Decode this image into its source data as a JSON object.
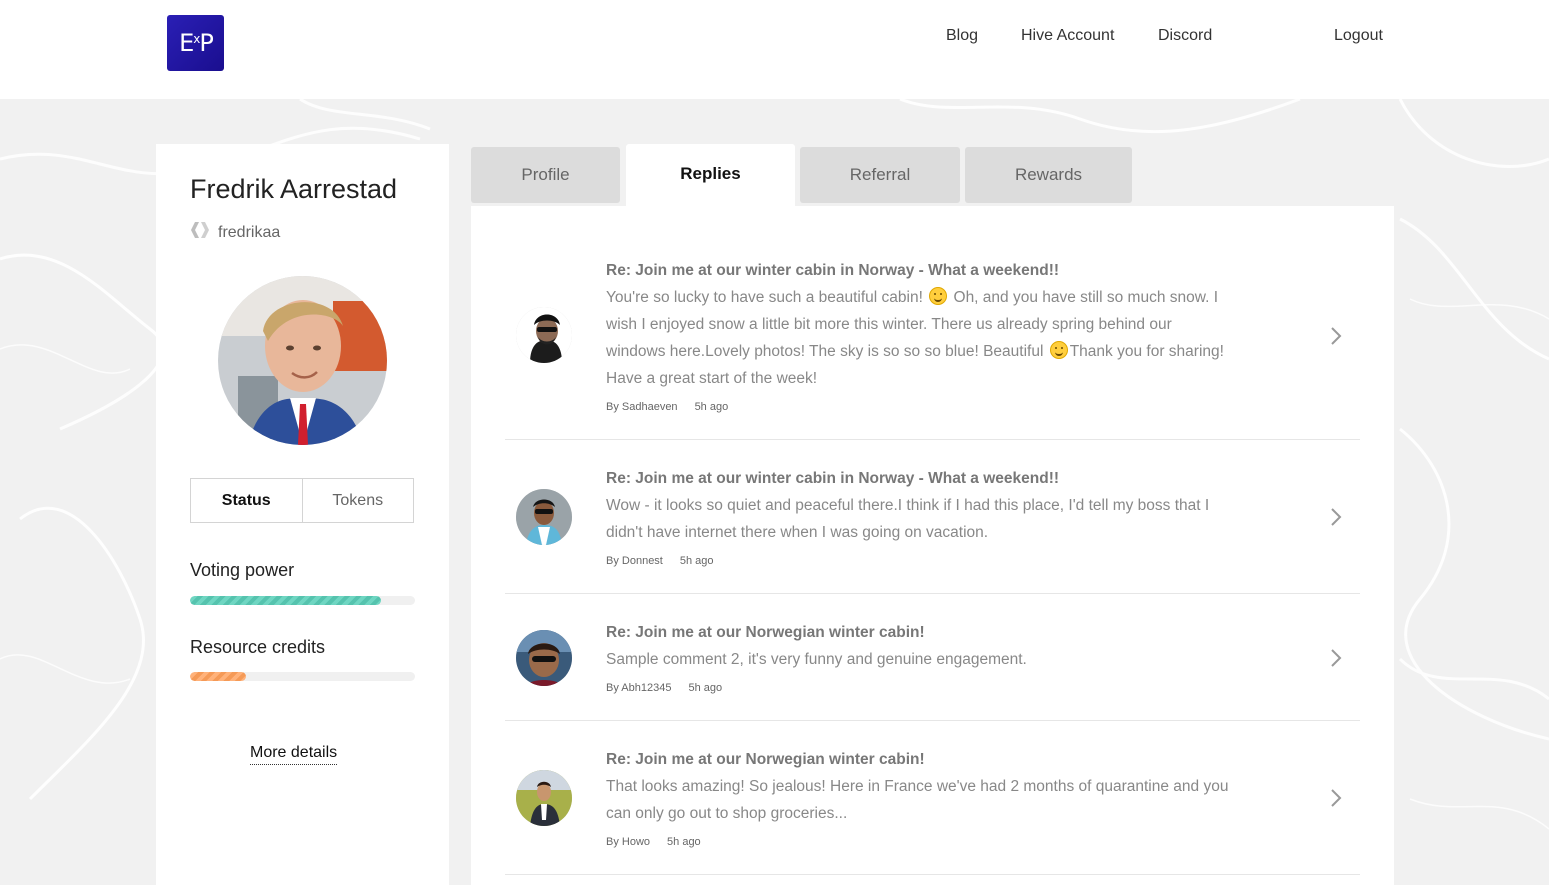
{
  "header": {
    "logo_text": "ExP",
    "nav": [
      {
        "label": "Blog"
      },
      {
        "label": "Hive Account"
      },
      {
        "label": "Discord"
      },
      {
        "label": "Logout"
      }
    ]
  },
  "profile": {
    "name": "Fredrik Aarrestad",
    "handle": "fredrikaa",
    "handle_icon": "hive-icon",
    "toggle": {
      "status": "Status",
      "tokens": "Tokens",
      "selected": "Status"
    },
    "voting_power_label": "Voting power",
    "voting_power_fraction": 0.85,
    "resource_credits_label": "Resource credits",
    "resource_credits_fraction": 0.25,
    "more_details": "More details"
  },
  "tabs": [
    {
      "label": "Profile",
      "active": false
    },
    {
      "label": "Replies",
      "active": true
    },
    {
      "label": "Referral",
      "active": false
    },
    {
      "label": "Rewards",
      "active": false
    }
  ],
  "replies": [
    {
      "title": "Re: Join me at our winter cabin in Norway - What a weekend!!",
      "lines": [
        "You're so lucky to have such a beautiful cabin! [emoji] Oh, and you have still so much snow. I",
        "wish I enjoyed snow a little bit more this winter. There us already spring behind our",
        "windows here.Lovely photos! The sky is so so so blue! Beautiful [emoji]Thank you for sharing!",
        "Have a great start of the week!"
      ],
      "author": "By Sadhaeven",
      "time": "5h ago"
    },
    {
      "title": "Re: Join me at our winter cabin in Norway - What a weekend!!",
      "lines": [
        "Wow - it looks so quiet and peaceful there.I think if I had this place, I'd tell my boss that I",
        "didn't have internet there when I was going on vacation."
      ],
      "author": "By Donnest",
      "time": "5h ago"
    },
    {
      "title": "Re: Join me at our Norwegian winter cabin!",
      "lines": [
        "Sample comment 2, it's very funny and genuine engagement."
      ],
      "author": "By Abh12345",
      "time": "5h ago"
    },
    {
      "title": "Re: Join me at our Norwegian winter cabin!",
      "lines": [
        "That looks amazing! So jealous! Here in France we've had 2 months of quarantine and you",
        "can only go out to shop groceries..."
      ],
      "author": "By Howo",
      "time": "5h ago"
    }
  ],
  "colors": {
    "logo": "#1a0e8f",
    "voting_bar": "#6fd6c2",
    "resource_bar": "#ffb27a",
    "emoji": "#ffce3d"
  }
}
